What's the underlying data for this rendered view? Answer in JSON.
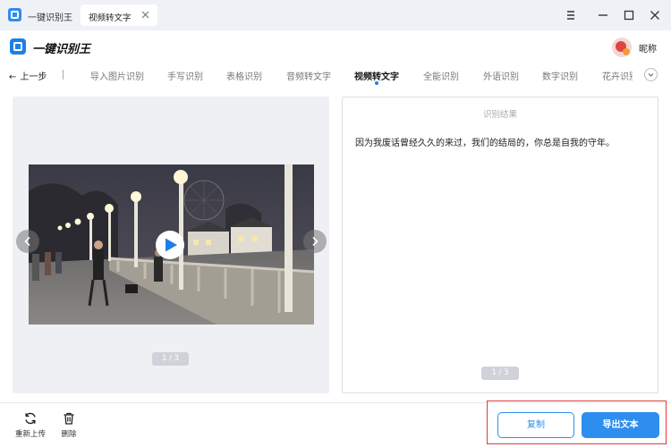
{
  "titlebar": {
    "app_tab_label": "一键识别王",
    "doc_tab_label": "视频转文字"
  },
  "appbar": {
    "brand_name": "一键识别王",
    "nickname": "昵称"
  },
  "nav": {
    "back_label": "上一步",
    "tabs": [
      {
        "label": "导入图片识别"
      },
      {
        "label": "手写识别"
      },
      {
        "label": "表格识别"
      },
      {
        "label": "音频转文字"
      },
      {
        "label": "视频转文字",
        "active": true
      },
      {
        "label": "全能识别"
      },
      {
        "label": "外语识别"
      },
      {
        "label": "数字识别"
      },
      {
        "label": "花卉识别"
      }
    ]
  },
  "preview": {
    "pager": "1 / 3"
  },
  "result": {
    "title": "识别结果",
    "text": "因为我废话曾经久久的来过，我们的结局的，你总是自我的守年。",
    "pager": "1 / 3"
  },
  "toolbar": {
    "reupload_label": "重新上传",
    "delete_label": "删除",
    "copy_label": "复制",
    "export_label": "导出文本"
  },
  "colors": {
    "accent": "#2e8ef0",
    "highlight_border": "#e53935"
  }
}
